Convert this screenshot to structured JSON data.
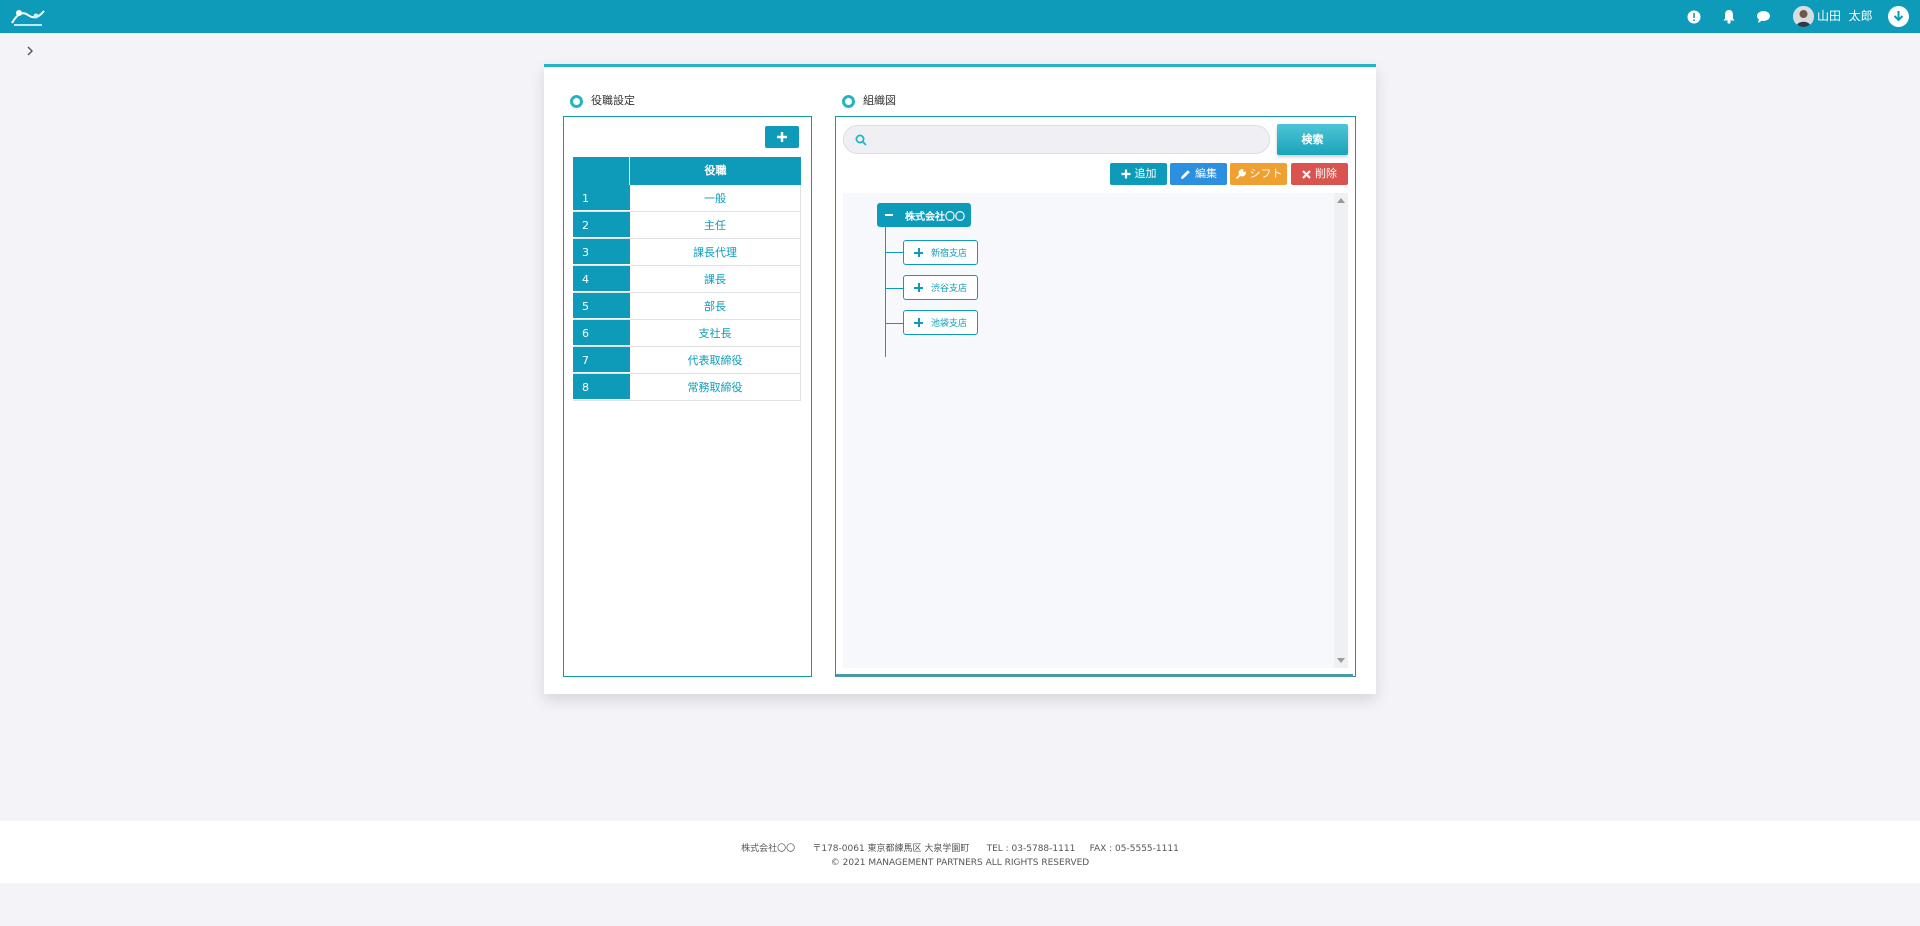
{
  "colors": {
    "primary": "#0e9bba",
    "accent": "#25b5c2",
    "edit": "#2d8fe0",
    "shift": "#f0a030",
    "delete": "#d9534f"
  },
  "header": {
    "logo_icon": "app-logo",
    "icons": [
      "alert-icon",
      "bell-icon",
      "chat-icon"
    ],
    "user_name": "山田  太郎",
    "download_icon": "download-icon"
  },
  "breadcrumb": {
    "icon": "chevron-right-icon"
  },
  "positions": {
    "title": "役職設定",
    "column_header": "役職",
    "rows": [
      {
        "num": "1",
        "name": "一般"
      },
      {
        "num": "2",
        "name": "主任"
      },
      {
        "num": "3",
        "name": "課長代理"
      },
      {
        "num": "4",
        "name": "課長"
      },
      {
        "num": "5",
        "name": "部長"
      },
      {
        "num": "6",
        "name": "支社長"
      },
      {
        "num": "7",
        "name": "代表取締役"
      },
      {
        "num": "8",
        "name": "常務取締役"
      }
    ]
  },
  "org": {
    "title": "組織図",
    "search": {
      "value": "",
      "placeholder": "",
      "button": "検索"
    },
    "actions": {
      "add": "追加",
      "edit": "編集",
      "shift": "シフト",
      "delete": "削除"
    },
    "root": "株式会社〇〇",
    "branches": [
      "新宿支店",
      "渋谷支店",
      "池袋支店"
    ]
  },
  "footer": {
    "company": "株式会社〇〇",
    "address": "〒178-0061 東京都練馬区 大泉学園町",
    "tel": "TEL : 03-5788-1111",
    "fax": "FAX : 05-5555-1111",
    "copyright": "© 2021 MANAGEMENT PARTNERS ALL RIGHTS RESERVED"
  }
}
